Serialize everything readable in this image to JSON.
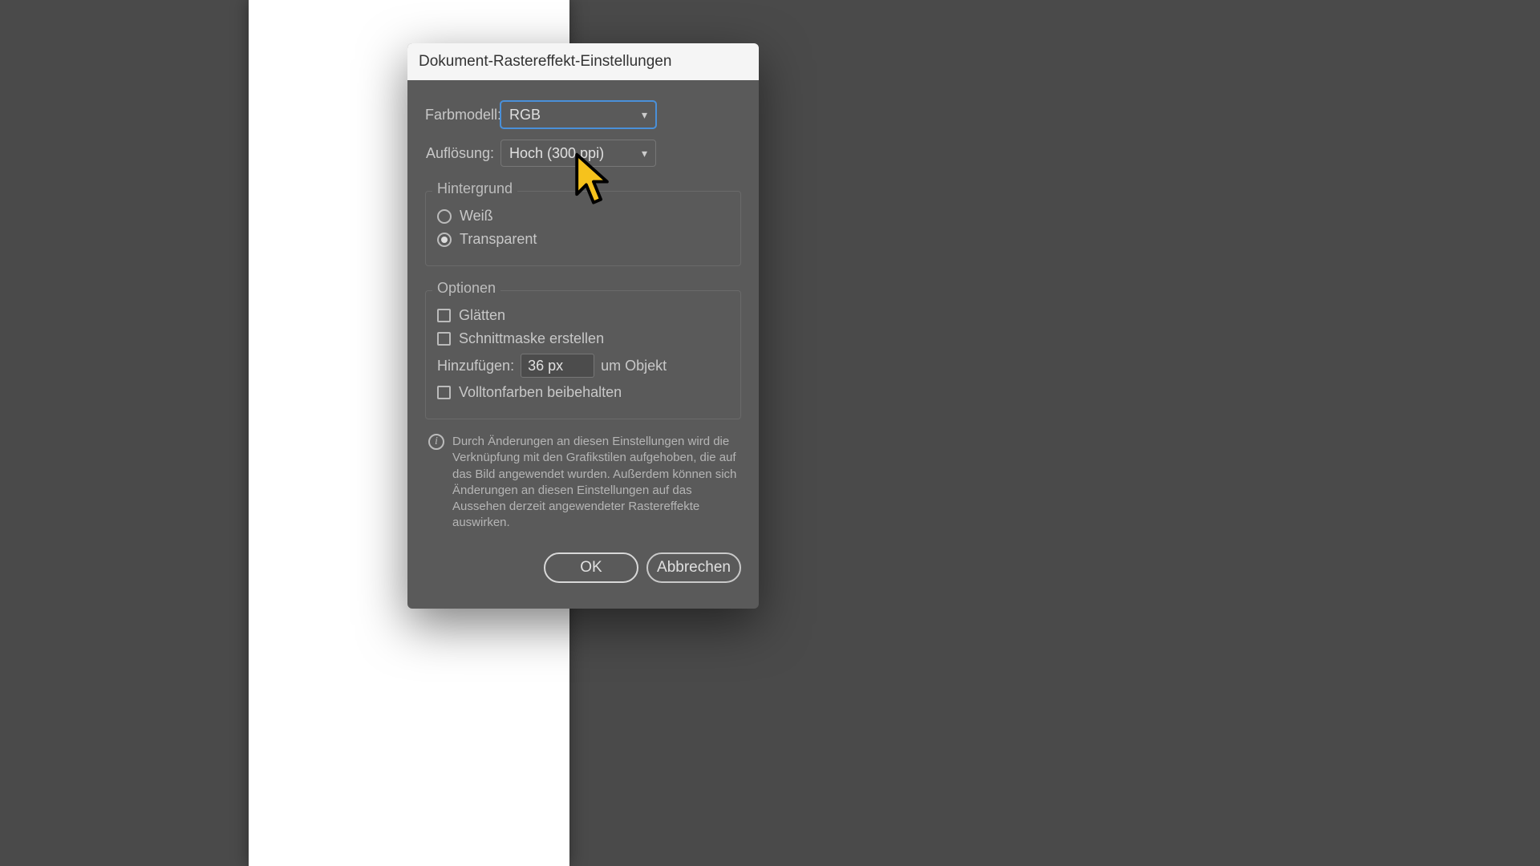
{
  "dialog": {
    "title": "Dokument-Rastereffekt-Einstellungen",
    "color_model": {
      "label": "Farbmodell:",
      "value": "RGB"
    },
    "resolution": {
      "label": "Auflösung:",
      "value": "Hoch (300 ppi)"
    },
    "background": {
      "group_label": "Hintergrund",
      "white": {
        "label": "Weiß",
        "checked": false
      },
      "transparent": {
        "label": "Transparent",
        "checked": true
      }
    },
    "options": {
      "group_label": "Optionen",
      "antialias": {
        "label": "Glätten",
        "checked": false
      },
      "clipmask": {
        "label": "Schnittmaske erstellen",
        "checked": false
      },
      "add": {
        "label_before": "Hinzufügen:",
        "value": "36 px",
        "label_after": "um Objekt"
      },
      "preserve_spot": {
        "label": "Volltonfarben beibehalten",
        "checked": false
      }
    },
    "info_text": "Durch Änderungen an diesen Einstellungen wird die Verknüpfung mit den Grafikstilen aufgehoben, die auf das Bild angewendet wurden. Außerdem können sich Änderungen an diesen Einstellungen auf das Aussehen derzeit angewendeter Rastereffekte auswirken.",
    "buttons": {
      "ok": "OK",
      "cancel": "Abbrechen"
    }
  }
}
